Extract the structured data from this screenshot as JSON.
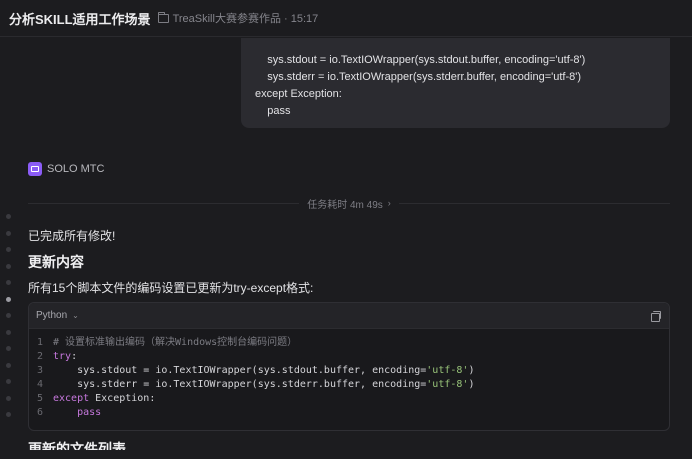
{
  "header": {
    "title": "分析SKILL适用工作场景",
    "meta": "TreaSkill大赛参赛作品 · 15:17"
  },
  "user_message": {
    "lines": [
      "    sys.stdout = io.TextIOWrapper(sys.stdout.buffer, encoding='utf-8')",
      "    sys.stderr = io.TextIOWrapper(sys.stderr.buffer, encoding='utf-8')",
      "except Exception:",
      "    pass"
    ]
  },
  "agent": {
    "name": "SOLO MTC"
  },
  "task": {
    "duration_label": "任务耗时 4m 49s"
  },
  "response": {
    "done_text": "已完成所有修改!",
    "section_title": "更新内容",
    "description": "所有15个脚本文件的编码设置已更新为try-except格式:",
    "next_heading": "更新的文件列表"
  },
  "code": {
    "language": "Python",
    "lines": [
      {
        "num": "1",
        "tokens": [
          {
            "t": "cm",
            "v": "# 设置标准输出编码（解决Windows控制台编码问题）"
          }
        ]
      },
      {
        "num": "2",
        "tokens": [
          {
            "t": "kw",
            "v": "try"
          },
          {
            "t": "tx",
            "v": ":"
          }
        ]
      },
      {
        "num": "3",
        "tokens": [
          {
            "t": "tx",
            "v": "    sys.stdout = io.TextIOWrapper(sys.stdout.buffer, encoding="
          },
          {
            "t": "st",
            "v": "'utf-8'"
          },
          {
            "t": "tx",
            "v": ")"
          }
        ]
      },
      {
        "num": "4",
        "tokens": [
          {
            "t": "tx",
            "v": "    sys.stderr = io.TextIOWrapper(sys.stderr.buffer, encoding="
          },
          {
            "t": "st",
            "v": "'utf-8'"
          },
          {
            "t": "tx",
            "v": ")"
          }
        ]
      },
      {
        "num": "5",
        "tokens": [
          {
            "t": "kw",
            "v": "except"
          },
          {
            "t": "tx",
            "v": " Exception:"
          }
        ]
      },
      {
        "num": "6",
        "tokens": [
          {
            "t": "kw",
            "v": "    pass"
          }
        ]
      }
    ]
  },
  "icons": {
    "folder": "folder-icon",
    "agent": "solo-agent-icon",
    "chevron": "chevron-right-icon",
    "language_chevron": "chevron-down-icon",
    "copy": "copy-icon"
  },
  "colors": {
    "accent": "#8b5cf6",
    "keyword": "#c678dd",
    "string": "#98c379",
    "comment": "#7d7d84"
  }
}
